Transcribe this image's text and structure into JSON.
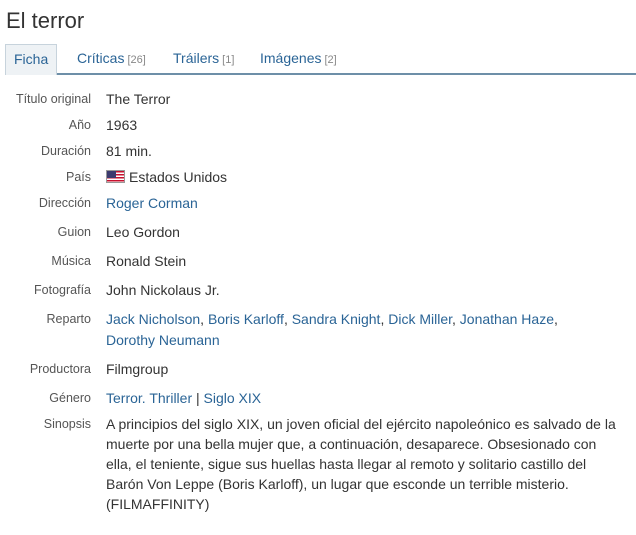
{
  "title": "El terror",
  "tabs": [
    {
      "label": "Ficha",
      "count": ""
    },
    {
      "label": "Críticas",
      "count": "[26]"
    },
    {
      "label": "Tráilers",
      "count": "[1]"
    },
    {
      "label": "Imágenes",
      "count": "[2]"
    }
  ],
  "details": {
    "titulo_original": {
      "label": "Título original",
      "value": "The Terror"
    },
    "anio": {
      "label": "Año",
      "value": "1963"
    },
    "duracion": {
      "label": "Duración",
      "value": "81 min."
    },
    "pais": {
      "label": "País",
      "value": "Estados Unidos",
      "flag_icon": "us-flag-icon"
    },
    "direccion": {
      "label": "Dirección",
      "value": "Roger Corman"
    },
    "guion": {
      "label": "Guion",
      "value": "Leo Gordon"
    },
    "musica": {
      "label": "Música",
      "value": "Ronald Stein"
    },
    "fotografia": {
      "label": "Fotografía",
      "value": "John Nickolaus Jr."
    },
    "reparto": {
      "label": "Reparto",
      "cast": [
        "Jack Nicholson",
        "Boris Karloff",
        "Sandra Knight",
        "Dick Miller",
        "Jonathan Haze",
        "Dorothy Neumann"
      ]
    },
    "productora": {
      "label": "Productora",
      "value": "Filmgroup"
    },
    "genero": {
      "label": "Género",
      "genre": "Terror",
      "subgenre": "Thriller",
      "separator": "|",
      "topic": "Siglo XIX"
    },
    "sinopsis": {
      "label": "Sinopsis",
      "lines": [
        "A principios del siglo XIX, un joven oficial del ejército napoleónico es salvado de la",
        "muerte por una bella mujer que, a continuación, desaparece. Obsesionado con",
        "ella, el teniente, sigue sus huellas hasta llegar al remoto y solitario castillo del",
        "Barón Von Leppe (Boris Karloff), un lugar que esconde un terrible misterio.",
        "(FILMAFFINITY)"
      ]
    }
  },
  "colors": {
    "link": "#2a6496",
    "tab_border": "#6d8fa8",
    "text": "#333333",
    "label": "#555555"
  }
}
